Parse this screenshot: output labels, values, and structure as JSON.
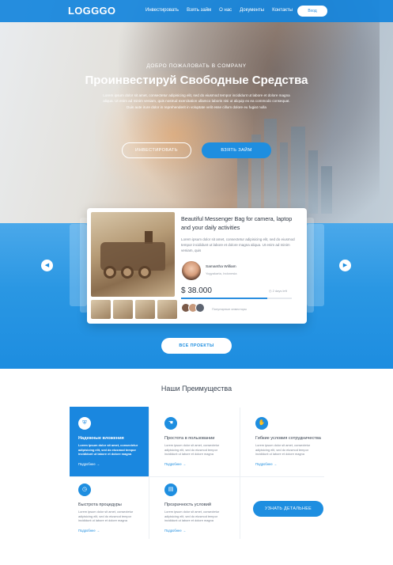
{
  "nav": {
    "logo": "LOGGGO",
    "links": [
      "Инвестировать",
      "Взять займ",
      "О нас",
      "Документы",
      "Контакты"
    ],
    "login": "Вход"
  },
  "hero": {
    "welcome": "ДОБРО ПОЖАЛОВАТЬ В COMPANY",
    "headline": "Проинвестируй Свободные Средства",
    "lead": "Lorem ipsum dolor sit amet, consectetur adipisicing elit, sed do eiusmod tempor incididunt ut labore et dolore magna aliqua. Ut enim ad minim veniam, quis nostrud exercitation ullamco laboris nisi ut aliquip ex ea commodo consequat. Duis aute irure dolor in reprehenderit in voluptate velit esse cillum dolore eu fugiat nulla",
    "btn_invest": "ИНВЕСТИРОВАТЬ",
    "btn_loan": "ВЗЯТЬ ЗАЙМ"
  },
  "project": {
    "title": "Beautiful Messenger Bag for camera, laptop and your daily activities",
    "description": "Lorem ipsum dolor sit amet, consectetur adipisicing elit, sed do eiusmod tempor incididunt ut labore et dolore magna aliqua. Ut enim ad minim veniam, quis",
    "author_name": "Samantha William",
    "author_location": "Yogyakarta, Indonesia",
    "amount": "$ 38.000",
    "days_left": "2 days left",
    "progress": 0.78,
    "investors_label": "Популярные инвесторы",
    "all_projects": "ВСЕ ПРОЕКТЫ"
  },
  "features": {
    "title": "Наши Преимущества",
    "more_label": "Подробнее",
    "items": [
      {
        "title": "Надежные вложения",
        "text": "Lorem ipsum dolor sit amet, consectetur adipisicing elit, sed do eiusmod tempor incididunt ut labore et dolore magna",
        "icon": "shield-icon"
      },
      {
        "title": "Простота  в пользовании",
        "text": "Lorem ipsum dolor sit amet, consectetur adipisicing elit, sed do eiusmod tempor incididunt ut labore et dolore magna",
        "icon": "hand-icon"
      },
      {
        "title": "Гибкие условия сотрудничества",
        "text": "Lorem ipsum dolor sit amet, consectetur adipisicing elit, sed do eiusmod tempor incididunt ut labore et dolore magna",
        "icon": "handshake-icon"
      },
      {
        "title": "Быстрота процедуры",
        "text": "Lorem ipsum dolor sit amet, consectetur adipisicing elit, sed do eiusmod tempor incididunt ut labore et dolore magna",
        "icon": "clock-icon"
      },
      {
        "title": "Прозрачность условий",
        "text": "Lorem ipsum dolor sit amet, consectetur adipisicing elit, sed do eiusmod tempor incididunt ut labore et dolore magna",
        "icon": "document-icon"
      }
    ],
    "btn_more": "УЗНАТЬ ДЕТАЛЬНЕЕ"
  },
  "colors": {
    "accent": "#1e8ee0",
    "active_card": "#1a87df"
  }
}
